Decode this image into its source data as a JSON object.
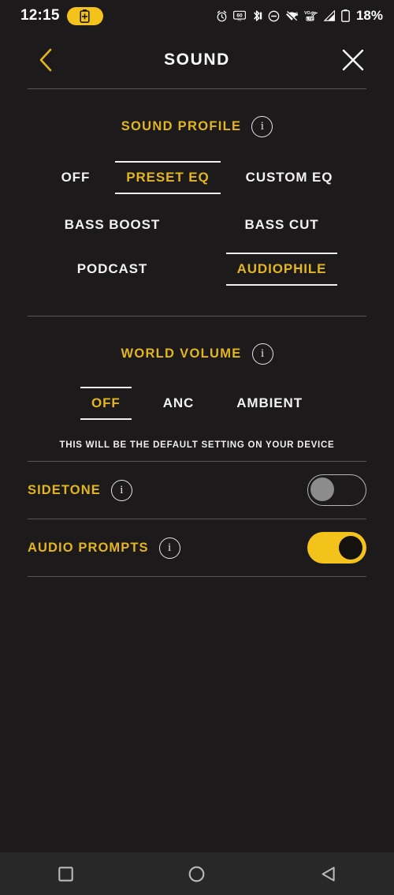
{
  "status_bar": {
    "time": "12:15",
    "battery_percent": "18%",
    "battery_saver_icon": "battery-saver-icon",
    "icons": [
      "alarm-icon",
      "refresh-rate-60hz-icon",
      "bluetooth-icon",
      "do-not-disturb-icon",
      "wifi-off-6-icon",
      "volte-icon",
      "cellular-signal-icon",
      "battery-icon"
    ]
  },
  "header": {
    "title": "SOUND",
    "back_icon": "back-chevron-icon",
    "close_icon": "close-x-icon"
  },
  "sound_profile": {
    "label": "SOUND PROFILE",
    "info_icon": "info-icon",
    "options": [
      {
        "label": "OFF",
        "selected": false
      },
      {
        "label": "PRESET EQ",
        "selected": true
      },
      {
        "label": "CUSTOM EQ",
        "selected": false
      }
    ],
    "presets": [
      {
        "label": "BASS BOOST",
        "selected": false
      },
      {
        "label": "BASS CUT",
        "selected": false
      },
      {
        "label": "PODCAST",
        "selected": false
      },
      {
        "label": "AUDIOPHILE",
        "selected": true
      }
    ]
  },
  "world_volume": {
    "label": "WORLD VOLUME",
    "info_icon": "info-icon",
    "options": [
      {
        "label": "OFF",
        "selected": true
      },
      {
        "label": "ANC",
        "selected": false
      },
      {
        "label": "AMBIENT",
        "selected": false
      }
    ],
    "note": "THIS WILL BE THE DEFAULT SETTING ON YOUR DEVICE"
  },
  "toggles": [
    {
      "label": "SIDETONE",
      "info_icon": "info-icon",
      "state": "off"
    },
    {
      "label": "AUDIO PROMPTS",
      "info_icon": "info-icon",
      "state": "on"
    }
  ],
  "nav_bar": {
    "recents_icon": "square-recents-icon",
    "home_icon": "circle-home-icon",
    "back_icon": "triangle-back-icon"
  },
  "colors": {
    "accent": "#e3b51f",
    "toggle_on": "#f3c31c",
    "background": "#1c1a1a",
    "text": "#f2f2f2",
    "divider": "#585551"
  }
}
